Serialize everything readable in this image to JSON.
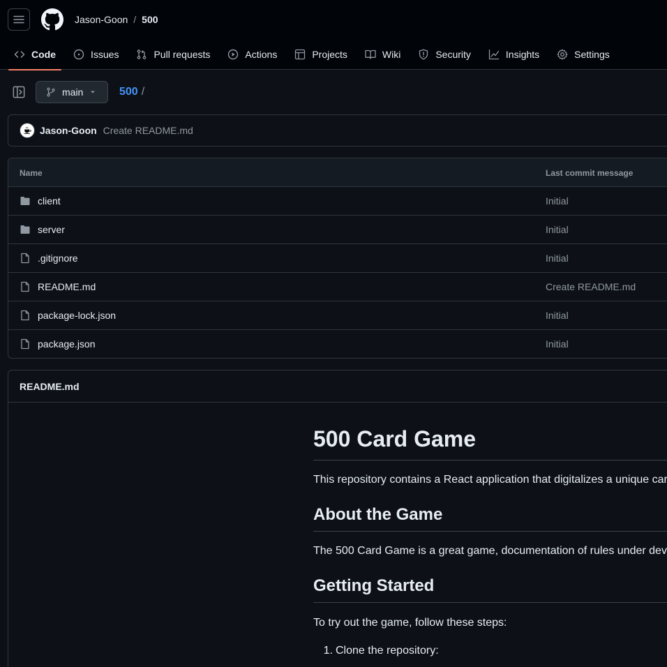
{
  "header": {
    "owner": "Jason-Goon",
    "separator": "/",
    "repo": "500"
  },
  "tabs": [
    {
      "label": "Code",
      "icon": "code-icon",
      "selected": true
    },
    {
      "label": "Issues",
      "icon": "issue-opened-icon"
    },
    {
      "label": "Pull requests",
      "icon": "git-pull-request-icon"
    },
    {
      "label": "Actions",
      "icon": "play-icon"
    },
    {
      "label": "Projects",
      "icon": "table-icon"
    },
    {
      "label": "Wiki",
      "icon": "book-icon"
    },
    {
      "label": "Security",
      "icon": "shield-icon"
    },
    {
      "label": "Insights",
      "icon": "graph-icon"
    },
    {
      "label": "Settings",
      "icon": "gear-icon"
    }
  ],
  "toolbar": {
    "branch": "main",
    "path_repo": "500",
    "path_slash": "/"
  },
  "commit": {
    "author": "Jason-Goon",
    "message": "Create README.md"
  },
  "files": {
    "header_name": "Name",
    "header_message": "Last commit message",
    "rows": [
      {
        "name": "client",
        "type": "folder",
        "message": "Initial"
      },
      {
        "name": "server",
        "type": "folder",
        "message": "Initial"
      },
      {
        "name": ".gitignore",
        "type": "file",
        "message": "Initial"
      },
      {
        "name": "README.md",
        "type": "file",
        "message": "Create README.md"
      },
      {
        "name": "package-lock.json",
        "type": "file",
        "message": "Initial"
      },
      {
        "name": "package.json",
        "type": "file",
        "message": "Initial"
      }
    ]
  },
  "readme": {
    "title": "README.md",
    "h1": "500 Card Game",
    "intro": "This repository contains a React application that digitalizes a unique car",
    "h2_about": "About the Game",
    "about_text": "The 500 Card Game is a great game, documentation of rules under dev",
    "h2_start": "Getting Started",
    "start_text": "To try out the game, follow these steps:",
    "step1_num": "1.",
    "step1": "Clone the repository:"
  },
  "colors": {
    "background": "#0d1117",
    "header_bg": "#010409",
    "border": "#30363d",
    "accent_link": "#4493f8",
    "tab_underline": "#f78166",
    "muted_text": "#9198a1"
  }
}
